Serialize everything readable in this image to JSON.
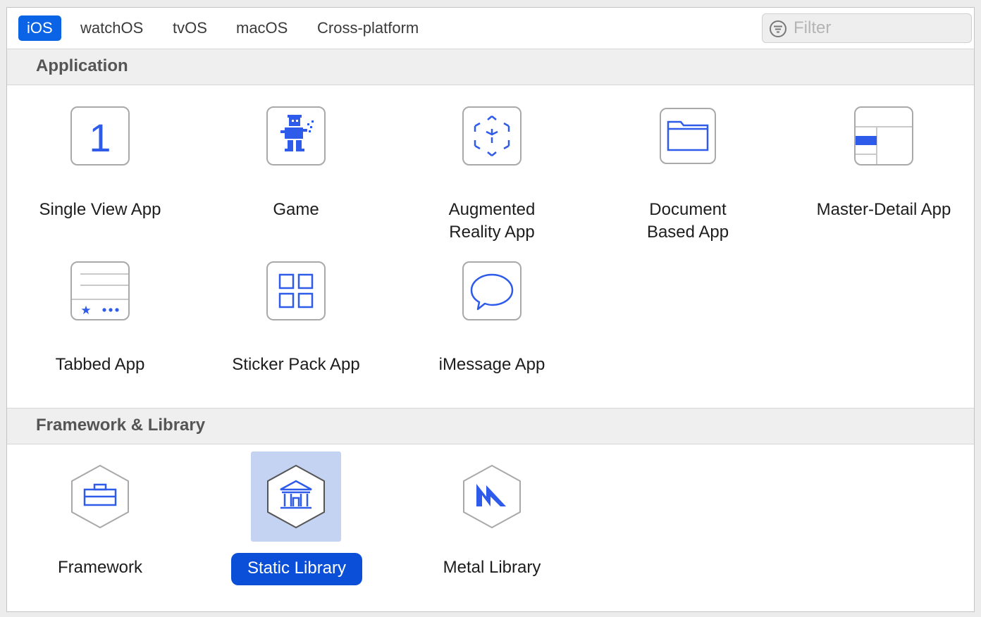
{
  "tabs": [
    {
      "label": "iOS",
      "active": true
    },
    {
      "label": "watchOS",
      "active": false
    },
    {
      "label": "tvOS",
      "active": false
    },
    {
      "label": "macOS",
      "active": false
    },
    {
      "label": "Cross-platform",
      "active": false
    }
  ],
  "filter": {
    "placeholder": "Filter",
    "icon": "filter-icon"
  },
  "sections": {
    "application": {
      "title": "Application",
      "items": [
        {
          "label": "Single View App",
          "icon": "single-view-icon"
        },
        {
          "label": "Game",
          "icon": "game-icon"
        },
        {
          "label": "Augmented\nReality App",
          "icon": "ar-cube-icon"
        },
        {
          "label": "Document\nBased App",
          "icon": "folder-icon"
        },
        {
          "label": "Master-Detail App",
          "icon": "master-detail-icon"
        },
        {
          "label": "Tabbed App",
          "icon": "tab-bar-icon"
        },
        {
          "label": "Sticker Pack App",
          "icon": "grid-icon"
        },
        {
          "label": "iMessage App",
          "icon": "speech-bubble-icon"
        }
      ]
    },
    "framework": {
      "title": "Framework & Library",
      "items": [
        {
          "label": "Framework",
          "icon": "toolbox-icon"
        },
        {
          "label": "Static Library",
          "icon": "bank-icon",
          "selected": true
        },
        {
          "label": "Metal Library",
          "icon": "metal-icon"
        }
      ]
    }
  },
  "colors": {
    "accent": "#0b63e5",
    "selection": "#c4d3f1",
    "icon_blue": "#2f5bea"
  }
}
